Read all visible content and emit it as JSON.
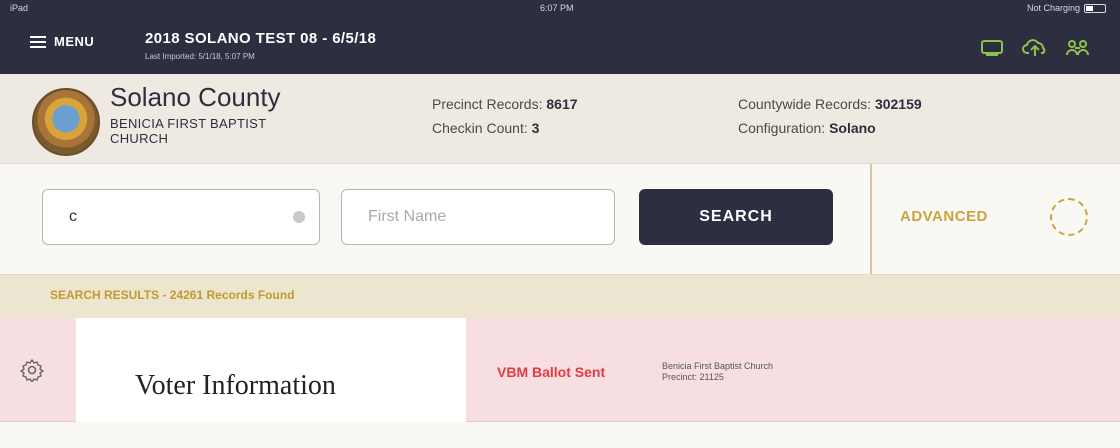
{
  "status_bar": {
    "device": "iPad",
    "time": "6:07 PM",
    "battery_text": "Not Charging"
  },
  "header": {
    "menu_label": "MENU",
    "title": "2018 SOLANO TEST 08 - 6/5/18",
    "subtitle": "Last Imported: 5/1/18, 5:07 PM",
    "icons": [
      "ballot-icon",
      "cloud-upload-icon",
      "users-icon"
    ],
    "icon_color": "#8bc34a"
  },
  "county": {
    "name": "Solano County",
    "site": "BENICIA FIRST BAPTIST CHURCH",
    "precinct_label": "Precinct Records:",
    "precinct_value": "8617",
    "checkin_label": "Checkin Count:",
    "checkin_value": "3",
    "countywide_label": "Countywide Records:",
    "countywide_value": "302159",
    "config_label": "Configuration:",
    "config_value": "Solano"
  },
  "search": {
    "last_name_value": "c",
    "first_name_placeholder": "First Name",
    "search_label": "SEARCH",
    "advanced_label": "ADVANCED"
  },
  "results": {
    "summary": "SEARCH RESULTS - 24261 Records Found",
    "row": {
      "voter_label": "Voter Information",
      "status": "VBM Ballot Sent",
      "site": "Benicia First Baptist Church",
      "precinct": "Precinct: 21125"
    }
  },
  "colors": {
    "header_bg": "#2d2e3f",
    "accent_gold": "#c9a43f",
    "status_red": "#e23b44",
    "row_bg": "#f7dfe1"
  }
}
